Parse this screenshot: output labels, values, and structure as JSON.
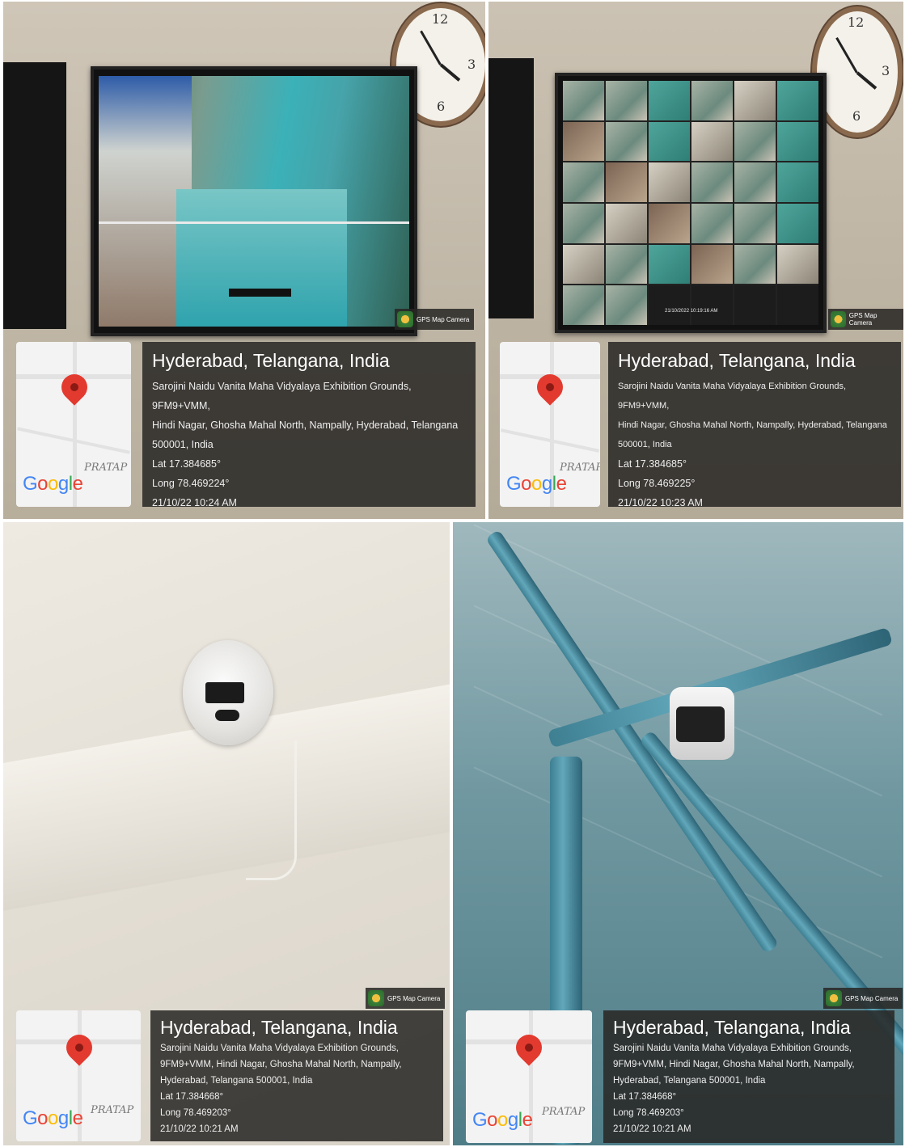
{
  "badge_label": "GPS Map Camera",
  "signature": "PRATAP",
  "panels": [
    {
      "city": "Hyderabad, Telangana, India",
      "address_lines": [
        "Sarojini Naidu Vanita Maha Vidyalaya Exhibition Grounds, 9FM9+VMM,",
        "Hindi Nagar, Ghosha Mahal North, Nampally, Hyderabad, Telangana",
        "500001, India"
      ],
      "lat": "Lat 17.384685°",
      "long": "Long 78.469224°",
      "datetime": "21/10/22 10:24 AM"
    },
    {
      "city": "Hyderabad, Telangana, India",
      "address_lines": [
        "Sarojini Naidu Vanita Maha Vidyalaya Exhibition Grounds, 9FM9+VMM,",
        "Hindi Nagar, Ghosha Mahal North, Nampally, Hyderabad, Telangana",
        "500001, India"
      ],
      "lat": "Lat 17.384685°",
      "long": "Long 78.469225°",
      "datetime": "21/10/22 10:23 AM"
    },
    {
      "city": "Hyderabad, Telangana, India",
      "address_lines": [
        "Sarojini Naidu Vanita Maha Vidyalaya Exhibition Grounds,",
        "9FM9+VMM, Hindi Nagar, Ghosha Mahal North, Nampally,",
        "Hyderabad, Telangana 500001, India"
      ],
      "lat": "Lat 17.384668°",
      "long": "Long 78.469203°",
      "datetime": "21/10/22 10:21 AM"
    },
    {
      "city": "Hyderabad, Telangana, India",
      "address_lines": [
        "Sarojini Naidu Vanita Maha Vidyalaya Exhibition Grounds,",
        "9FM9+VMM, Hindi Nagar, Ghosha Mahal North, Nampally,",
        "Hyderabad, Telangana 500001, India"
      ],
      "lat": "Lat 17.384668°",
      "long": "Long 78.469203°",
      "datetime": "21/10/22 10:21 AM"
    }
  ],
  "monitor_timestamp": "21/10/2022 10:19:16 AM"
}
